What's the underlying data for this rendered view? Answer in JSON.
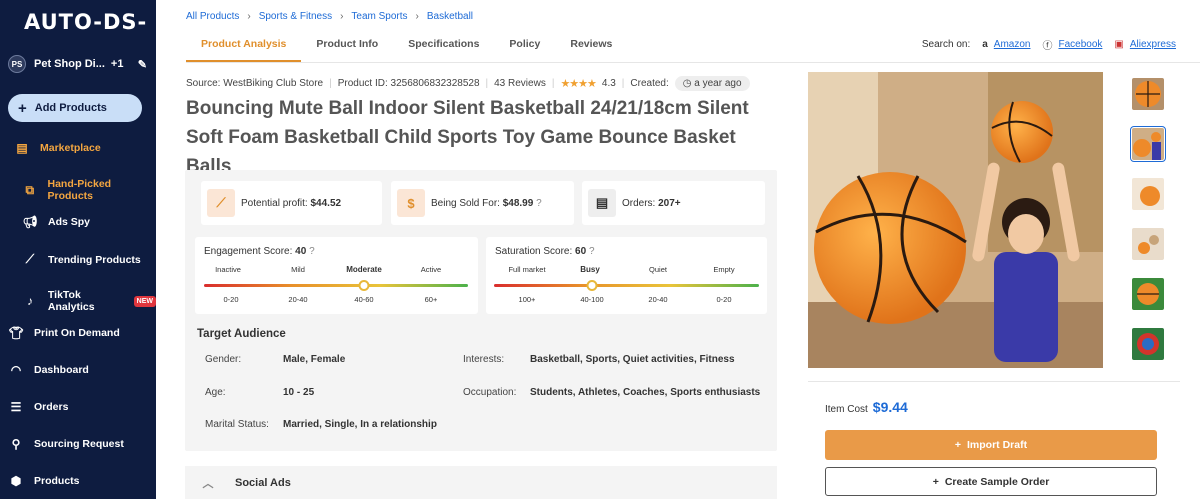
{
  "sidebar": {
    "logo": "AUTO-DS-",
    "store": {
      "initials": "PS",
      "name": "Pet Shop Di...",
      "extra": "+1"
    },
    "add_button": "Add Products",
    "items": [
      {
        "label": "Marketplace",
        "icon": "store-icon"
      },
      {
        "label": "Hand-Picked Products",
        "icon": "box-icon"
      },
      {
        "label": "Ads Spy",
        "icon": "megaphone-icon"
      },
      {
        "label": "Trending Products",
        "icon": "trend-icon"
      },
      {
        "label": "TikTok Analytics",
        "icon": "tiktok-icon",
        "badge": "NEW"
      },
      {
        "label": "Print On Demand",
        "icon": "shirt-icon"
      },
      {
        "label": "Dashboard",
        "icon": "gauge-icon"
      },
      {
        "label": "Orders",
        "icon": "orders-icon"
      },
      {
        "label": "Sourcing Request",
        "icon": "sourcing-icon"
      },
      {
        "label": "Products",
        "icon": "cube-icon"
      }
    ]
  },
  "breadcrumb": [
    "All Products",
    "Sports & Fitness",
    "Team Sports",
    "Basketball"
  ],
  "tabs": [
    "Product Analysis",
    "Product Info",
    "Specifications",
    "Policy",
    "Reviews"
  ],
  "search_on": {
    "label": "Search on:",
    "links": [
      "Amazon",
      "Facebook",
      "Aliexpress"
    ]
  },
  "meta": {
    "source": "Source: WestBiking Club Store",
    "product_id": "Product ID: 3256806832328528",
    "reviews": "43 Reviews",
    "rating": "4.3",
    "created_label": "Created:",
    "created_value": "a year ago"
  },
  "title": "Bouncing Mute Ball Indoor Silent Basketball 24/21/18cm Silent Soft Foam Basketball Child Sports Toy Game Bounce Basket Balls",
  "stats": {
    "profit_label": "Potential profit:",
    "profit_value": "$44.52",
    "sold_label": "Being Sold For:",
    "sold_value": "$48.99",
    "orders_label": "Orders:",
    "orders_value": "207+"
  },
  "engagement": {
    "label": "Engagement Score:",
    "value": "40",
    "levels": [
      "Inactive",
      "Mild",
      "Moderate",
      "Active"
    ],
    "ranges": [
      "0-20",
      "20-40",
      "40-60",
      "60+"
    ]
  },
  "saturation": {
    "label": "Saturation Score:",
    "value": "60",
    "levels": [
      "Full market",
      "Busy",
      "Quiet",
      "Empty"
    ],
    "ranges": [
      "100+",
      "40-100",
      "20-40",
      "0-20"
    ]
  },
  "audience": {
    "title": "Target Audience",
    "gender_label": "Gender:",
    "gender": "Male, Female",
    "age_label": "Age:",
    "age": "10 - 25",
    "marital_label": "Marital Status:",
    "marital": "Married, Single, In a relationship",
    "interests_label": "Interests:",
    "interests": "Basketball, Sports, Quiet activities, Fitness",
    "occupation_label": "Occupation:",
    "occupation": "Students, Athletes, Coaches, Sports enthusiasts"
  },
  "social_ads": "Social Ads",
  "item_cost": {
    "label": "Item Cost",
    "value": "$9.44"
  },
  "buttons": {
    "import": "Import Draft",
    "sample": "Create Sample Order"
  }
}
